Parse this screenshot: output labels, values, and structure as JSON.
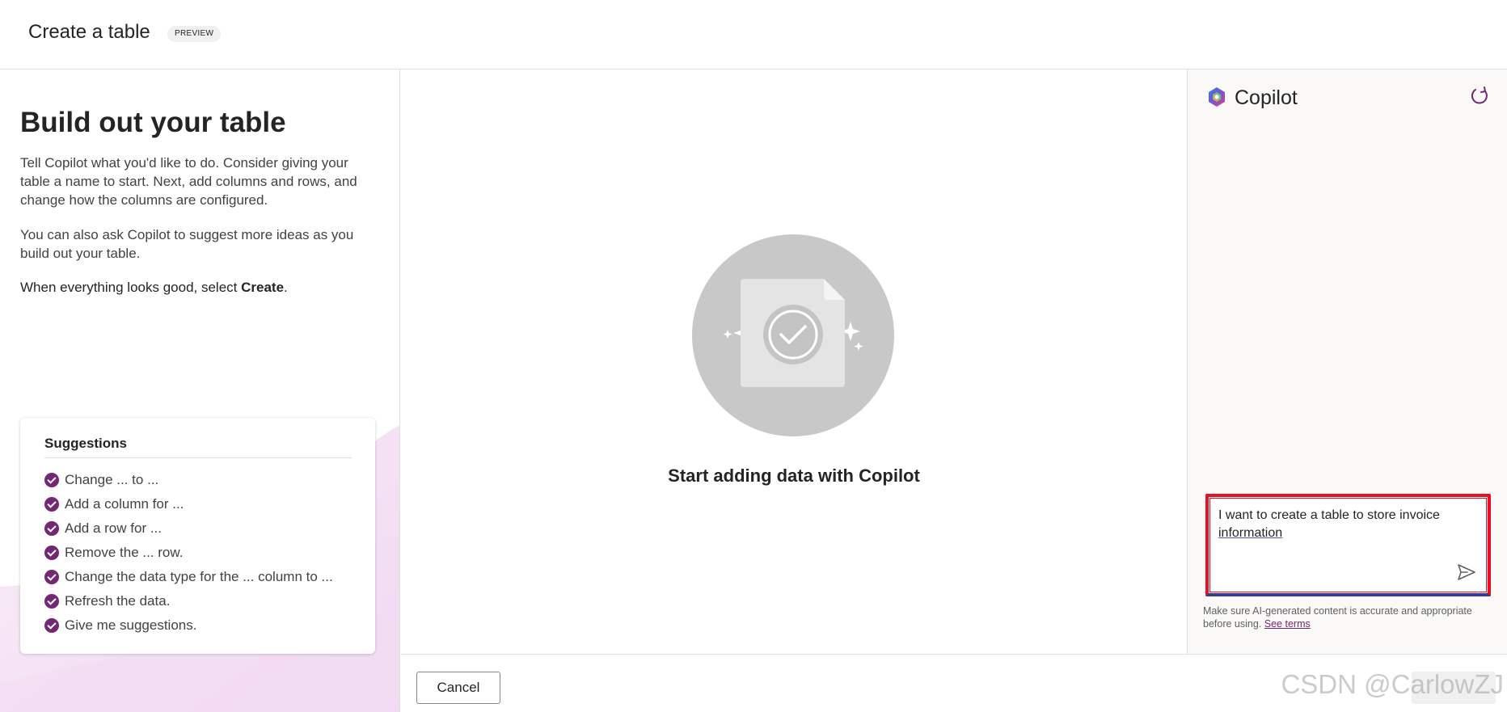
{
  "header": {
    "title": "Create a table",
    "badge": "PREVIEW"
  },
  "left": {
    "heading": "Build out your table",
    "para1": "Tell Copilot what you'd like to do. Consider giving your table a name to start. Next, add columns and rows, and change how the columns are configured.",
    "para2": "You can also ask Copilot to suggest more ideas as you build out your table.",
    "para3_prefix": "When everything looks good, select ",
    "para3_bold": "Create",
    "para3_suffix": "."
  },
  "suggestions": {
    "title": "Suggestions",
    "items": [
      "Change ... to ...",
      "Add a column for ...",
      "Add a row for ...",
      "Remove the ... row.",
      "Change the data type for the ... column to ...",
      "Refresh the data.",
      "Give me suggestions."
    ]
  },
  "center": {
    "empty_text": "Start adding data with Copilot"
  },
  "copilot": {
    "title": "Copilot",
    "input_text_1": "I want to create a table to store invoice",
    "input_text_2": "information",
    "disclaimer": "Make sure AI-generated content is accurate and appropriate before using.",
    "see_terms": "See terms"
  },
  "footer": {
    "cancel_label": "Cancel",
    "watermark": "CSDN @CarlowZJ"
  },
  "colors": {
    "accent": "#742774",
    "highlight_border": "#e81123"
  },
  "icons": {
    "check": "check-circle-icon",
    "refresh": "refresh-icon",
    "send": "send-icon",
    "copilot": "copilot-logo-icon"
  }
}
